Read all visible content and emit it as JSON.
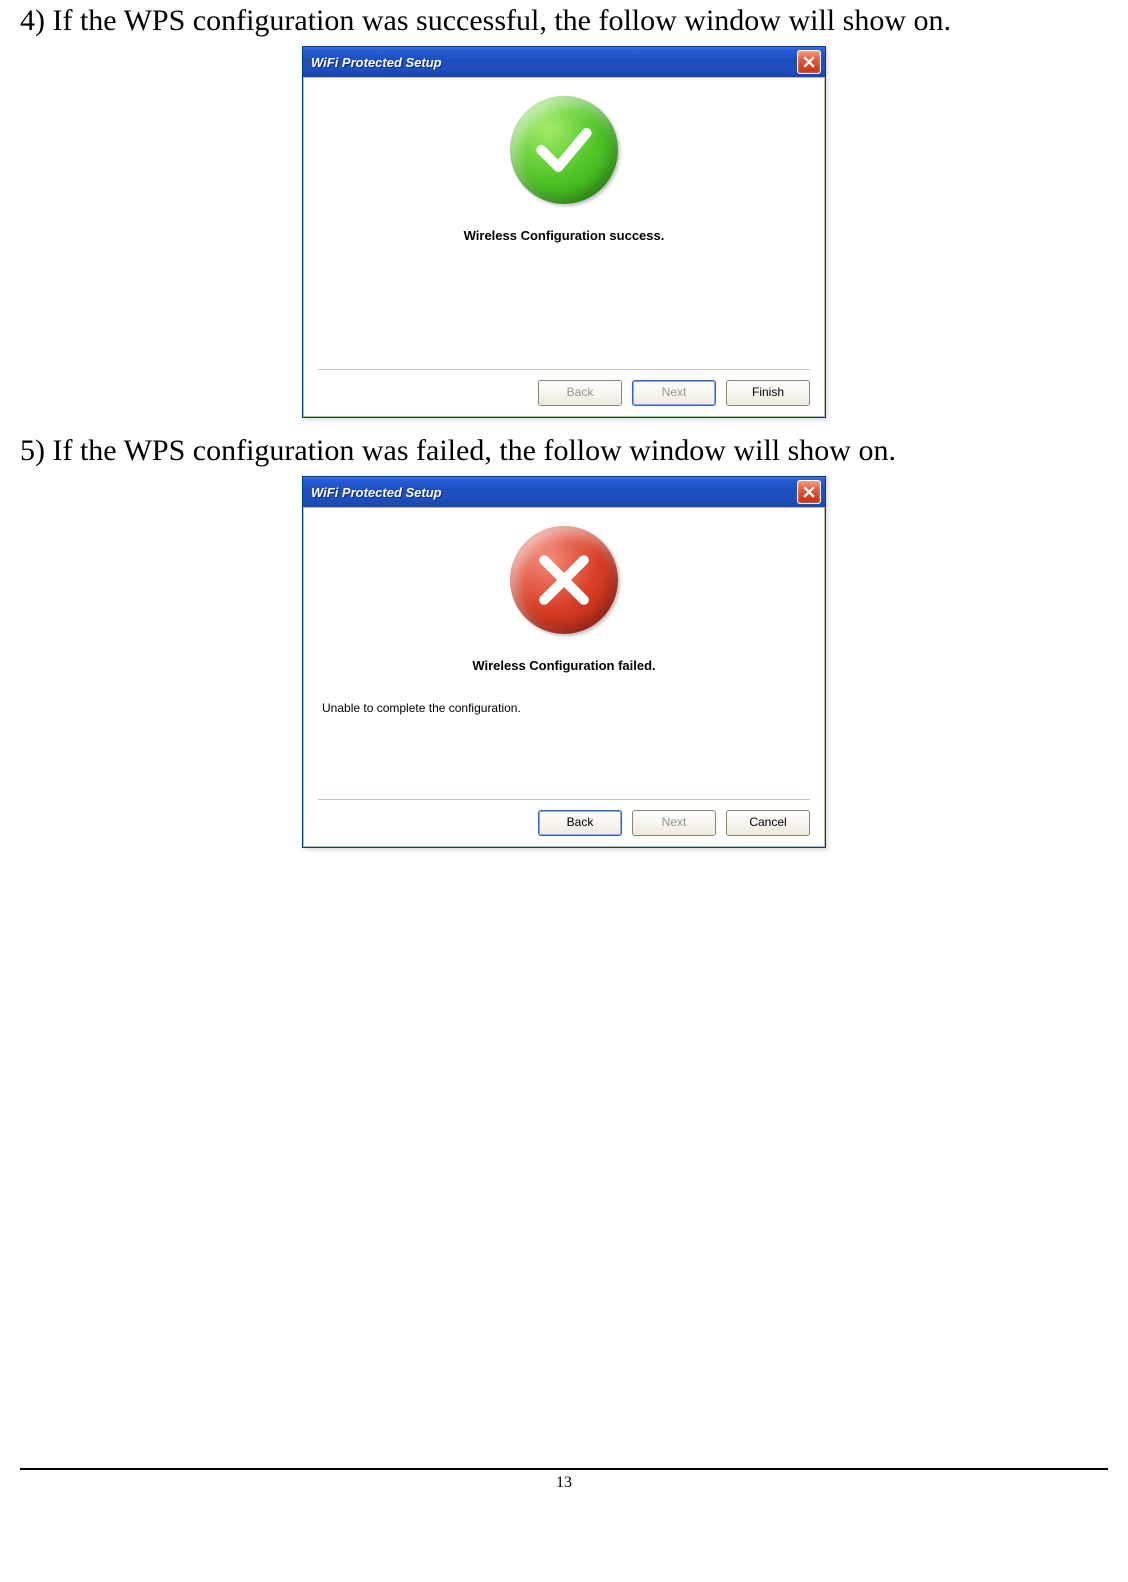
{
  "instructions": {
    "step4": "4) If the WPS configuration was successful, the follow window will show on.",
    "step5": "5) If the WPS configuration was failed, the follow window will show on."
  },
  "dialog_success": {
    "title": "WiFi Protected Setup",
    "message": "Wireless Configuration success.",
    "buttons": {
      "back": "Back",
      "next": "Next",
      "finish": "Finish"
    }
  },
  "dialog_fail": {
    "title": "WiFi Protected Setup",
    "message": "Wireless Configuration failed.",
    "sub_message": "Unable to complete the configuration.",
    "buttons": {
      "back": "Back",
      "next": "Next",
      "cancel": "Cancel"
    }
  },
  "page_number": "13"
}
